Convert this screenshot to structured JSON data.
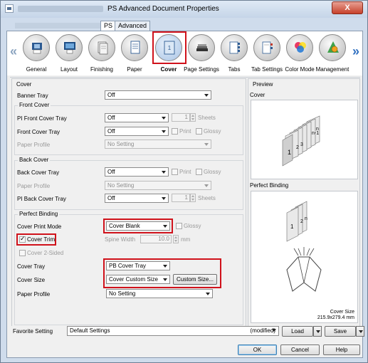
{
  "window": {
    "title": "PS Advanced Document Properties",
    "close_label": "X",
    "tabs": [
      {
        "label": "PS"
      },
      {
        "label": "Advanced"
      }
    ]
  },
  "iconbar": {
    "items": [
      {
        "label": "General",
        "icon": "general-icon"
      },
      {
        "label": "Layout",
        "icon": "layout-icon"
      },
      {
        "label": "Finishing",
        "icon": "finishing-icon"
      },
      {
        "label": "Paper",
        "icon": "paper-icon"
      },
      {
        "label": "Cover",
        "icon": "cover-icon",
        "selected": true
      },
      {
        "label": "Page Settings",
        "icon": "page-settings-icon"
      },
      {
        "label": "Tabs",
        "icon": "tabs-icon"
      },
      {
        "label": "Tab Settings",
        "icon": "tab-settings-icon"
      },
      {
        "label": "Color Mode",
        "icon": "color-mode-icon"
      },
      {
        "label": "Management",
        "icon": "management-icon"
      }
    ],
    "left_arrow": "«",
    "right_arrow": "»",
    "cover_glyph": "1"
  },
  "cover": {
    "section_title": "Cover",
    "banner_tray": {
      "label": "Banner Tray",
      "value": "Off"
    },
    "front_cover": {
      "title": "Front Cover",
      "pi_front_cover_tray": {
        "label": "PI Front Cover Tray",
        "value": "Off",
        "sheets_value": "1",
        "sheets_unit": "Sheets"
      },
      "front_cover_tray": {
        "label": "Front Cover Tray",
        "value": "Off",
        "print_label": "Print",
        "glossy_label": "Glossy"
      },
      "paper_profile": {
        "label": "Paper Profile",
        "value": "No Setting"
      }
    },
    "back_cover": {
      "title": "Back Cover",
      "back_cover_tray": {
        "label": "Back Cover Tray",
        "value": "Off",
        "print_label": "Print",
        "glossy_label": "Glossy"
      },
      "paper_profile": {
        "label": "Paper Profile",
        "value": "No Setting"
      },
      "pi_back_cover_tray": {
        "label": "PI Back Cover Tray",
        "value": "Off",
        "sheets_value": "1",
        "sheets_unit": "Sheets"
      }
    },
    "perfect_binding": {
      "title": "Perfect Binding",
      "cover_print_mode": {
        "label": "Cover Print Mode",
        "value": "Cover Blank",
        "glossy_label": "Glossy"
      },
      "cover_trim": {
        "label": "Cover Trim",
        "checked": true
      },
      "spine_width": {
        "label": "Spine Width",
        "value": "10.0",
        "unit": "mm"
      },
      "cover_2_sided": {
        "label": "Cover 2-Sided",
        "checked": false
      },
      "cover_tray": {
        "label": "Cover Tray",
        "value": "PB Cover Tray"
      },
      "cover_size": {
        "label": "Cover Size",
        "value": "Cover Custom Size",
        "custom_size_label": "Custom Size..."
      },
      "paper_profile": {
        "label": "Paper Profile",
        "value": "No Setting"
      }
    }
  },
  "preview": {
    "title": "Preview",
    "cover_label": "Cover",
    "perfect_binding_label": "Perfect Binding",
    "cover_size_caption": "Cover Size",
    "cover_size_value": "215.9x279.4 mm",
    "page_labels": [
      "1",
      "2",
      "3",
      "n-1",
      "n"
    ]
  },
  "favorite": {
    "label": "Favorite Setting",
    "value": "Default Settings",
    "modified": "(modified)",
    "load_label": "Load",
    "save_label": "Save"
  },
  "buttons": {
    "ok": "OK",
    "cancel": "Cancel",
    "help": "Help"
  }
}
